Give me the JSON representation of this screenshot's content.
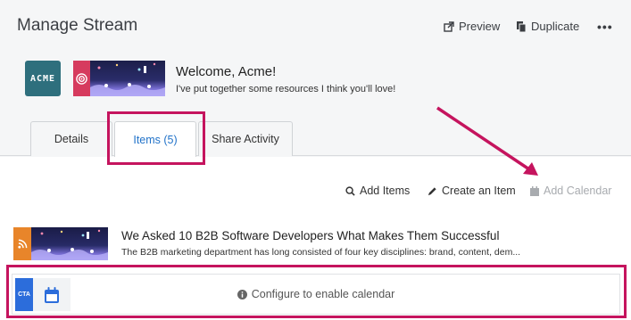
{
  "header": {
    "title": "Manage Stream",
    "preview_label": "Preview",
    "duplicate_label": "Duplicate",
    "more_label": "•••"
  },
  "stream": {
    "logo_text": "ACME",
    "welcome_title": "Welcome, Acme!",
    "welcome_subtitle": "I've put together some resources I think you'll love!"
  },
  "tabs": [
    {
      "label": "Details"
    },
    {
      "label": "Items (5)"
    },
    {
      "label": "Share Activity"
    }
  ],
  "actions": {
    "add_items": "Add Items",
    "create_item": "Create an Item",
    "add_calendar": "Add Calendar"
  },
  "items": [
    {
      "title": "We Asked 10 B2B Software Developers What Makes Them Successful",
      "description": "The B2B marketing department has long consisted of four key disciplines: brand, content, dem..."
    }
  ],
  "calendar_row": {
    "badge": "CTA",
    "message": "Configure to enable calendar"
  },
  "colors": {
    "accent": "#2273c9",
    "highlight": "#c5145e",
    "cta_badge": "#2c6ddb"
  }
}
